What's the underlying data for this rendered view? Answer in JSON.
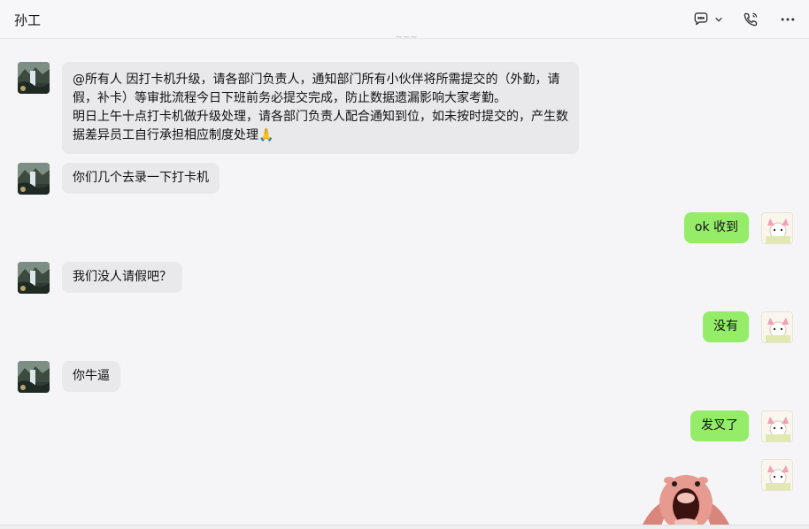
{
  "header": {
    "title": "孙工",
    "icons": [
      "chat-bubble-icon",
      "chevron-down-icon",
      "phone-icon",
      "more-icon"
    ]
  },
  "messages": [
    {
      "side": "left",
      "line1": "@所有人 因打卡机升级，请各部门负责人，通知部门所有小伙伴将所需提交的（外勤，请",
      "line2": "假，补卡）等审批流程今日下班前务必提交完成，防止数据遗漏影响大家考勤。",
      "line3": "明日上午十点打卡机做升级处理，请各部门负责人配合通知到位，如未按时提交的，产生数",
      "line4": "据差异员工自行承担相应制度处理🙏"
    },
    {
      "side": "left",
      "text": "你们几个去录一下打卡机"
    },
    {
      "side": "right",
      "text": "ok 收到"
    },
    {
      "side": "left",
      "text": "我们没人请假吧？"
    },
    {
      "side": "right",
      "text": "没有"
    },
    {
      "side": "left",
      "text": "你牛逼"
    },
    {
      "side": "right",
      "text": "发叉了"
    },
    {
      "side": "right",
      "sticker": "screaming-pig-sticker"
    }
  ],
  "colors": {
    "left_bubble": "#e9e9ec",
    "right_bubble": "#95ec69",
    "background": "#f5f5f7"
  }
}
